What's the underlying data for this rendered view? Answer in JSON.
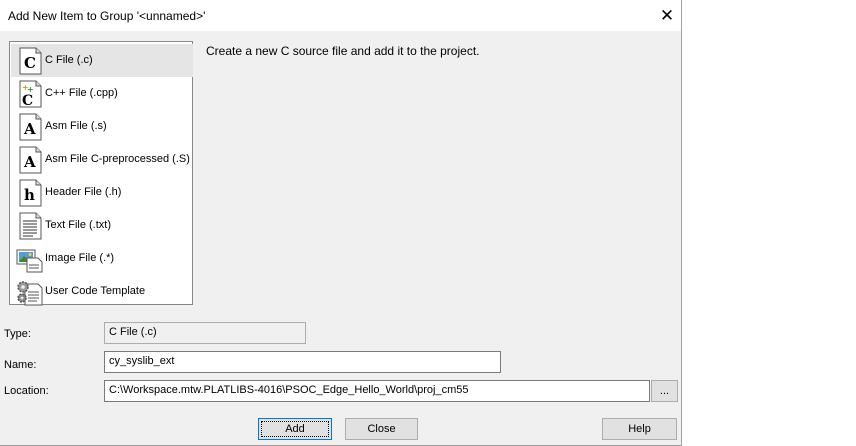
{
  "dialog": {
    "title": "Add New Item to Group '<unnamed>'",
    "close_glyph": "✕"
  },
  "items": [
    {
      "label": "C File (.c)",
      "icon": "c-file-icon",
      "selected": true
    },
    {
      "label": "C++ File (.cpp)",
      "icon": "cpp-file-icon",
      "selected": false
    },
    {
      "label": "Asm File (.s)",
      "icon": "asm-file-icon",
      "selected": false
    },
    {
      "label": "Asm File C-preprocessed (.S)",
      "icon": "asm-preprocessed-file-icon",
      "selected": false
    },
    {
      "label": "Header File (.h)",
      "icon": "header-file-icon",
      "selected": false
    },
    {
      "label": "Text File (.txt)",
      "icon": "text-file-icon",
      "selected": false
    },
    {
      "label": "Image File (.*)",
      "icon": "image-file-icon",
      "selected": false
    },
    {
      "label": "User Code Template",
      "icon": "user-code-template-icon",
      "selected": false
    }
  ],
  "description": "Create a new C source file and add it to the project.",
  "form": {
    "type_label": "Type:",
    "type_value": "C File (.c)",
    "name_label": "Name:",
    "name_value": "cy_syslib_ext",
    "location_label": "Location:",
    "location_value": "C:\\Workspace.mtw.PLATLIBS-4016\\PSOC_Edge_Hello_World\\proj_cm55",
    "browse_label": "..."
  },
  "buttons": {
    "add": "Add",
    "close": "Close",
    "help": "Help"
  }
}
